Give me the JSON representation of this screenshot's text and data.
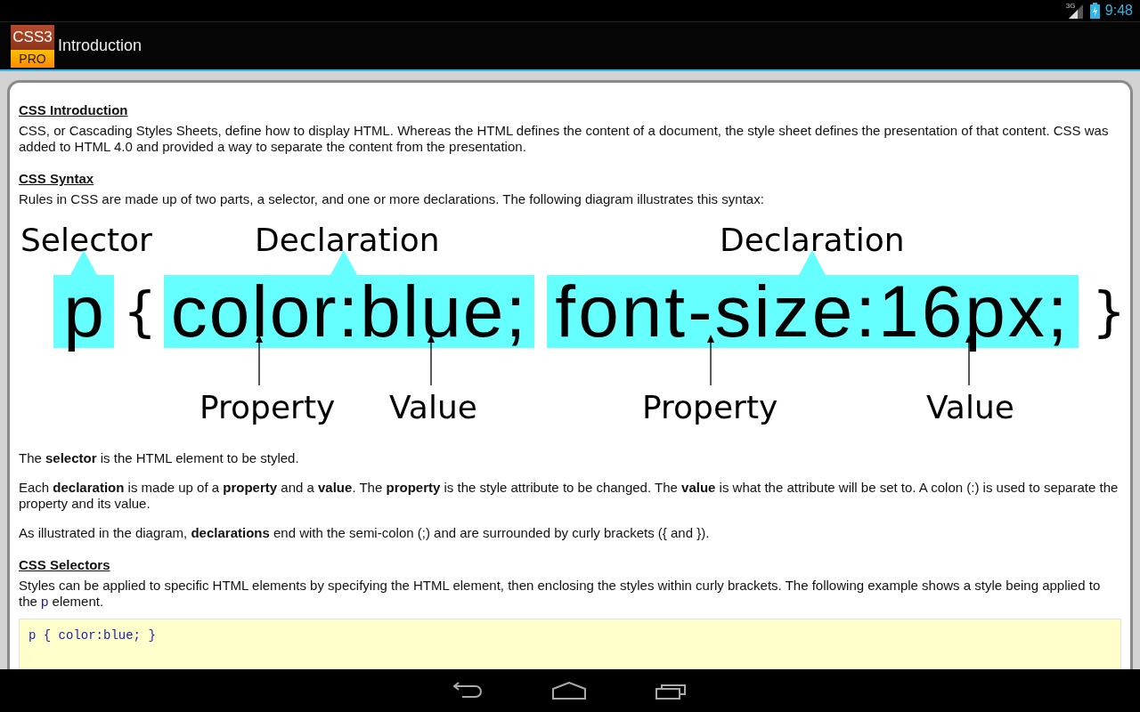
{
  "status_bar": {
    "network": "3G",
    "time": "9:48"
  },
  "action_bar": {
    "logo_top": "CSS3",
    "logo_bottom": "PRO",
    "title": "Introduction"
  },
  "article": [
    {
      "kind": "heading",
      "text": "CSS Introduction"
    },
    {
      "kind": "paragraph",
      "text": "CSS, or Cascading Styles Sheets, define how to display HTML. Whereas the HTML defines the content of a document, the style sheet defines the presentation of that content. CSS was added to HTML 4.0 and provided a way to separate the content from the presentation."
    },
    {
      "kind": "heading",
      "text": "CSS Syntax"
    },
    {
      "kind": "paragraph",
      "text": "Rules in CSS are made up of two parts, a selector, and one or more declarations. The following diagram illustrates this syntax:"
    },
    {
      "kind": "diagram",
      "selector_label": "Selector",
      "selector": "p",
      "open_brace": "{",
      "close_brace": "}",
      "declarations": [
        {
          "label": "Declaration",
          "text": "color:blue;",
          "property_label": "Property",
          "value_label": "Value"
        },
        {
          "label": "Declaration",
          "text": "font-size:16px;",
          "property_label": "Property",
          "value_label": "Value"
        }
      ]
    },
    {
      "kind": "paragraph",
      "text": "The **selector** is the HTML element to be styled."
    },
    {
      "kind": "paragraph",
      "text": "Each **declaration** is made up of a **property** and a **value**. The **property** is the style attribute to be changed. The **value** is what the attribute will be set to. A colon (:) is used to separate the property and its value."
    },
    {
      "kind": "paragraph",
      "text": "As illustrated in the diagram, **declarations** end with the semi-colon (;) and are surrounded by curly brackets ({ and })."
    },
    {
      "kind": "heading",
      "text": "CSS Selectors"
    },
    {
      "kind": "paragraph",
      "text": "Styles can be applied to specific HTML elements by specifying the HTML element, then enclosing the styles within curly brackets. The following example shows a style being applied to the ",
      "code": "p",
      "text_after": " element."
    },
    {
      "kind": "code",
      "text": "p { color:blue; }"
    }
  ]
}
